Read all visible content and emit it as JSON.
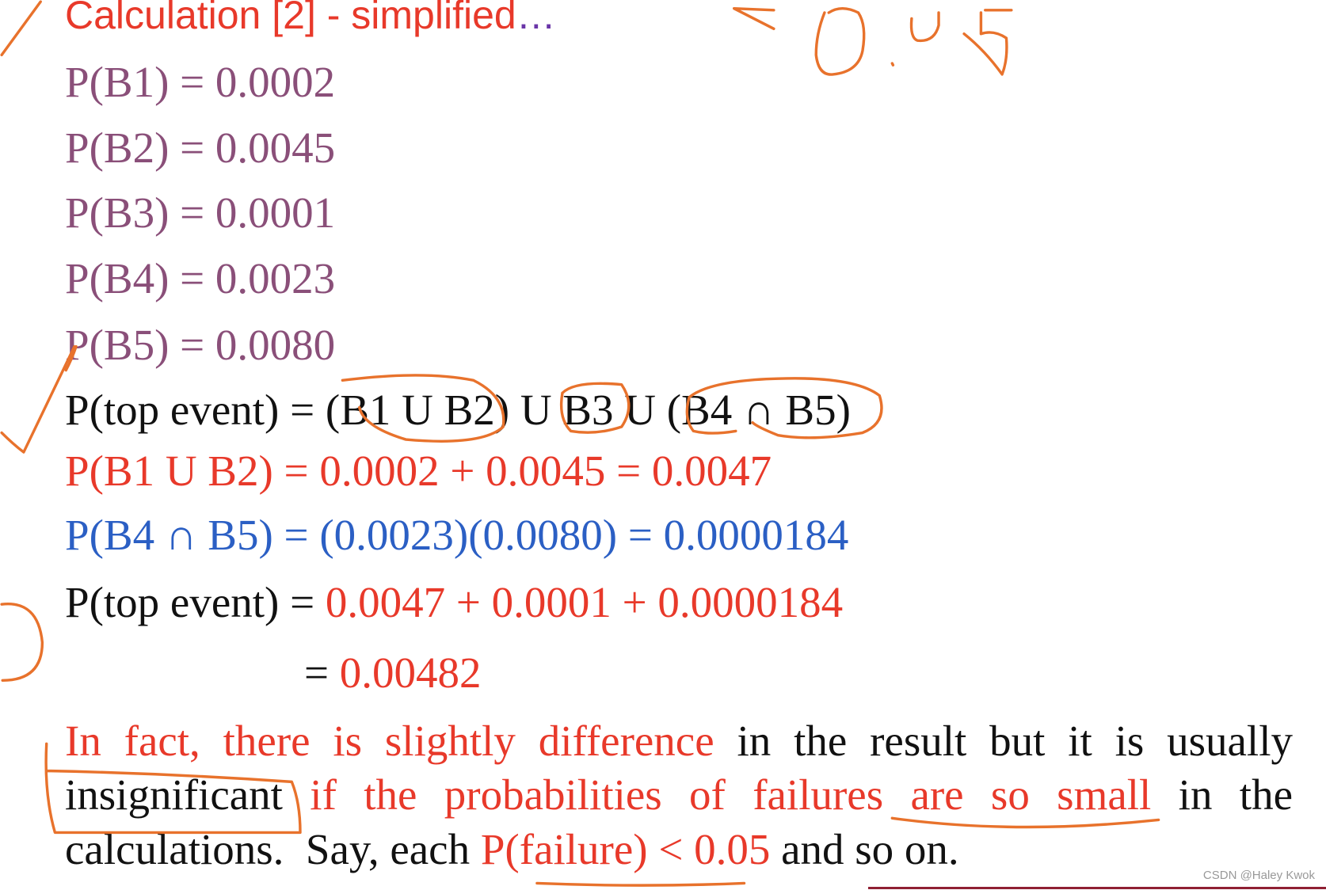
{
  "title": {
    "text": "Calculation [2] - simplified",
    "ellipsis": "…"
  },
  "probabilities": [
    "P(B1) = 0.0002",
    "P(B2) = 0.0045",
    "P(B3) = 0.0001",
    "P(B4) = 0.0023",
    "P(B5) = 0.0080"
  ],
  "top_event_expr": "P(top event) = (B1 U B2) U B3 U (B4 ∩ B5)",
  "union_calc": "P(B1 U B2) = 0.0002 + 0.0045 = 0.0047",
  "intersection_calc": "P(B4 ∩ B5) = (0.0023)(0.0080) = 0.0000184",
  "top_event_calc": {
    "label": "P(top event)",
    "eq": " = ",
    "sum": "0.0047 + 0.0001 + 0.0000184",
    "eq2": "= ",
    "result": "0.00482"
  },
  "paragraph": {
    "l1_red": "In fact, there is slightly difference",
    "l1_black": " in the result but it is usually",
    "l2_black1": "insignificant",
    "l2_red": " if the probabilities of failures are so small",
    "l2_black2": " in the",
    "l3_black1": "calculations.  Say, each ",
    "l3_red": "P(failure) < 0.05",
    "l3_black2": " and so on."
  },
  "handwriting": "< 0.05",
  "watermark": "CSDN @Haley Kwok",
  "colors": {
    "title": "#e8392a",
    "mauve": "#8a4f79",
    "red": "#e8392a",
    "blue": "#2b5fc4",
    "ink": "#e8722c"
  }
}
